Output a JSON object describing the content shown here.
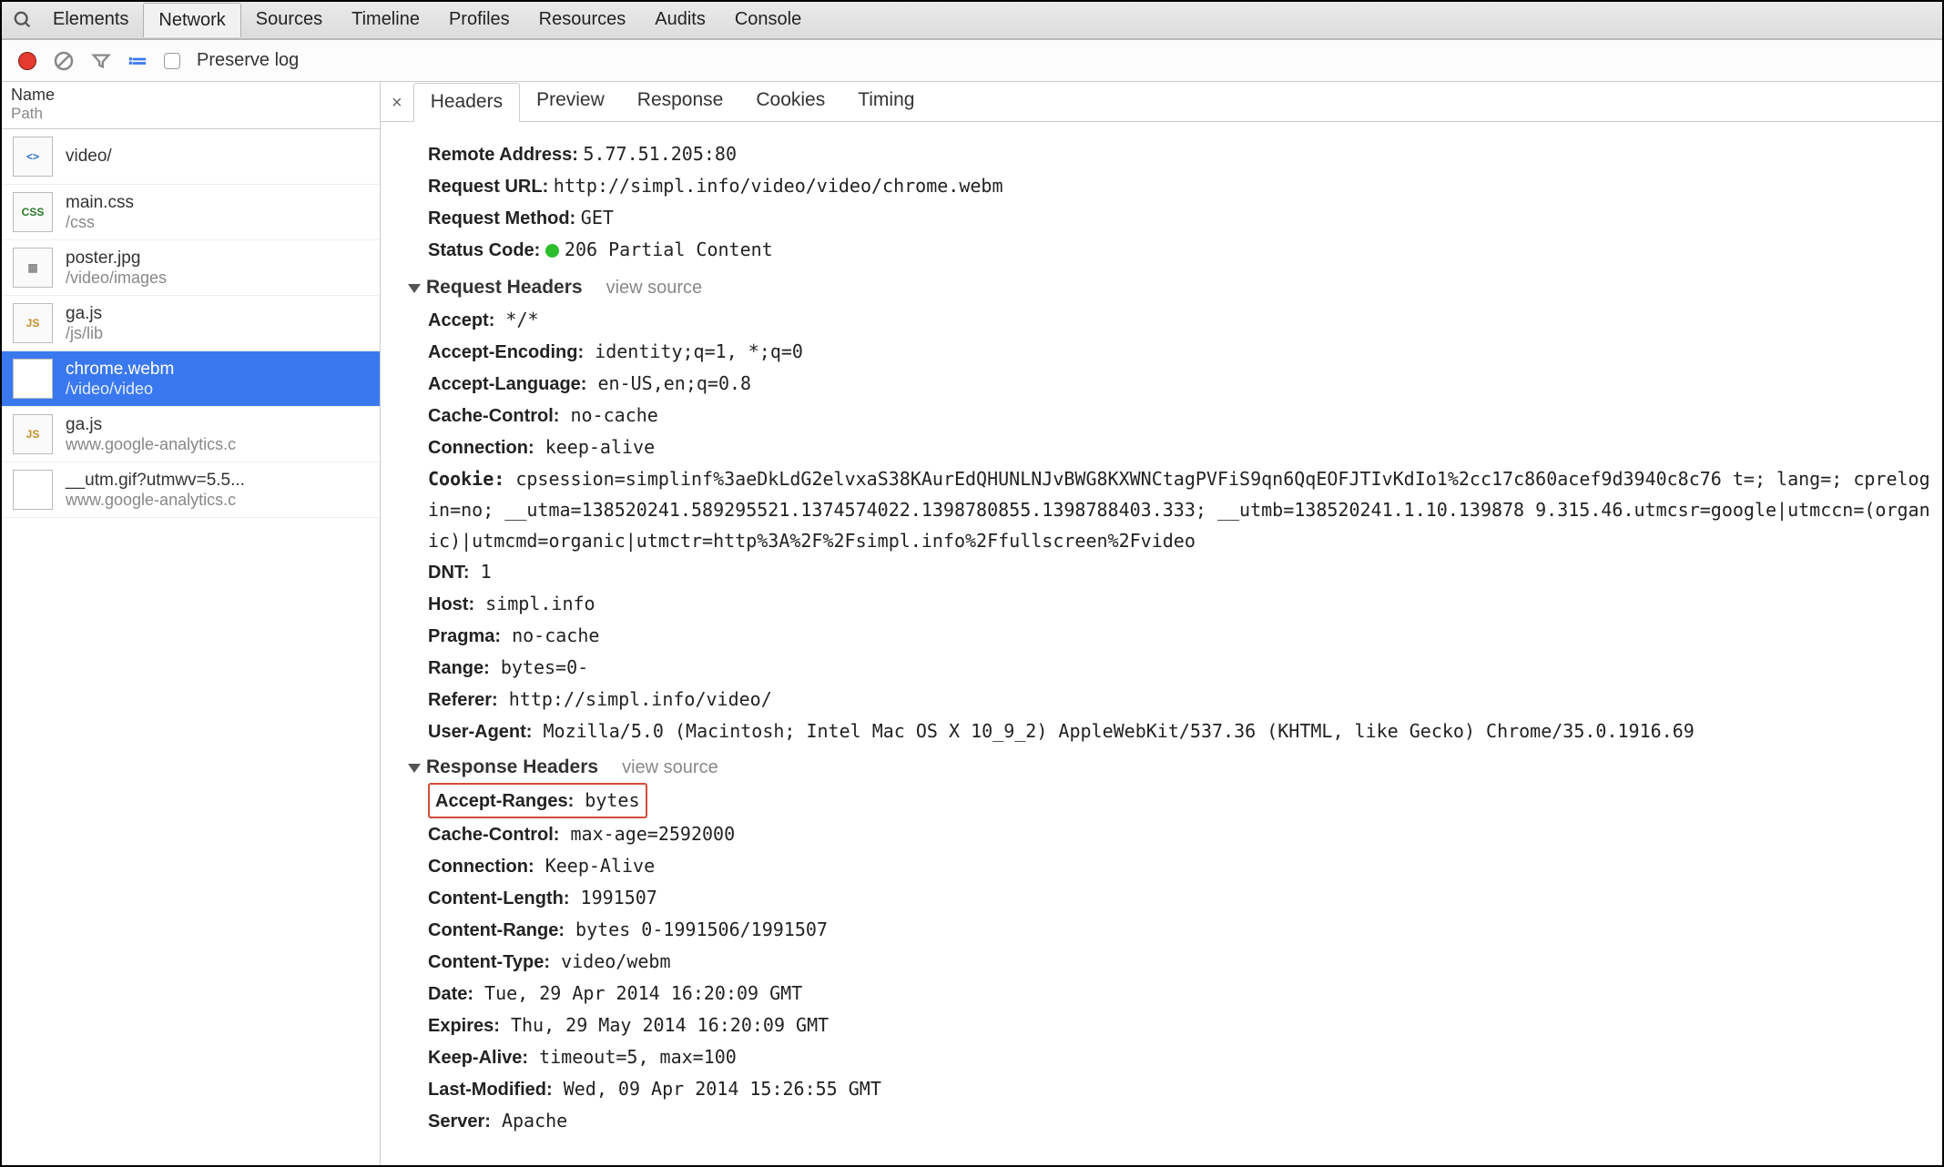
{
  "panels": [
    "Elements",
    "Network",
    "Sources",
    "Timeline",
    "Profiles",
    "Resources",
    "Audits",
    "Console"
  ],
  "active_panel": "Network",
  "toolbar": {
    "preserve_log": "Preserve log"
  },
  "list_header": {
    "name": "Name",
    "path": "Path"
  },
  "requests": [
    {
      "name": "video/",
      "path": "",
      "icon": "<>",
      "cls": "html"
    },
    {
      "name": "main.css",
      "path": "/css",
      "icon": "CSS",
      "cls": "css"
    },
    {
      "name": "poster.jpg",
      "path": "/video/images",
      "icon": "▦",
      "cls": "img"
    },
    {
      "name": "ga.js",
      "path": "/js/lib",
      "icon": "JS",
      "cls": "js"
    },
    {
      "name": "chrome.webm",
      "path": "/video/video",
      "icon": "",
      "cls": "media",
      "selected": true
    },
    {
      "name": "ga.js",
      "path": "www.google-analytics.c",
      "icon": "JS",
      "cls": "js"
    },
    {
      "name": "__utm.gif?utmwv=5.5...",
      "path": "www.google-analytics.c",
      "icon": "",
      "cls": "media"
    }
  ],
  "detail_tabs": [
    "Headers",
    "Preview",
    "Response",
    "Cookies",
    "Timing"
  ],
  "active_detail_tab": "Headers",
  "general": {
    "remote_address_k": "Remote Address:",
    "remote_address_v": "5.77.51.205:80",
    "request_url_k": "Request URL:",
    "request_url_v": "http://simpl.info/video/video/chrome.webm",
    "request_method_k": "Request Method:",
    "request_method_v": "GET",
    "status_code_k": "Status Code:",
    "status_code_v": "206 Partial Content"
  },
  "section_request_headers": "Request Headers",
  "section_response_headers": "Response Headers",
  "view_source": "view source",
  "request_headers": [
    {
      "k": "Accept:",
      "v": "*/*"
    },
    {
      "k": "Accept-Encoding:",
      "v": "identity;q=1, *;q=0"
    },
    {
      "k": "Accept-Language:",
      "v": "en-US,en;q=0.8"
    },
    {
      "k": "Cache-Control:",
      "v": "no-cache"
    },
    {
      "k": "Connection:",
      "v": "keep-alive"
    },
    {
      "k": "Cookie:",
      "v": "cpsession=simplinf%3aeDkLdG2elvxaS38KAurEdQHUNLNJvBWG8KXWNCtagPVFiS9qn6QqEOFJTIvKdIo1%2cc17c860acef9d3940c8c76 t=; lang=; cprelogin=no; __utma=138520241.589295521.1374574022.1398780855.1398788403.333; __utmb=138520241.1.10.139878 9.315.46.utmcsr=google|utmccn=(organic)|utmcmd=organic|utmctr=http%3A%2F%2Fsimpl.info%2Ffullscreen%2Fvideo"
    },
    {
      "k": "DNT:",
      "v": "1"
    },
    {
      "k": "Host:",
      "v": "simpl.info"
    },
    {
      "k": "Pragma:",
      "v": "no-cache"
    },
    {
      "k": "Range:",
      "v": "bytes=0-"
    },
    {
      "k": "Referer:",
      "v": "http://simpl.info/video/"
    },
    {
      "k": "User-Agent:",
      "v": "Mozilla/5.0 (Macintosh; Intel Mac OS X 10_9_2) AppleWebKit/537.36 (KHTML, like Gecko) Chrome/35.0.1916.69"
    }
  ],
  "response_headers": [
    {
      "k": "Accept-Ranges:",
      "v": "bytes",
      "highlight": true
    },
    {
      "k": "Cache-Control:",
      "v": "max-age=2592000"
    },
    {
      "k": "Connection:",
      "v": "Keep-Alive"
    },
    {
      "k": "Content-Length:",
      "v": "1991507"
    },
    {
      "k": "Content-Range:",
      "v": "bytes 0-1991506/1991507"
    },
    {
      "k": "Content-Type:",
      "v": "video/webm"
    },
    {
      "k": "Date:",
      "v": "Tue, 29 Apr 2014 16:20:09 GMT"
    },
    {
      "k": "Expires:",
      "v": "Thu, 29 May 2014 16:20:09 GMT"
    },
    {
      "k": "Keep-Alive:",
      "v": "timeout=5, max=100"
    },
    {
      "k": "Last-Modified:",
      "v": "Wed, 09 Apr 2014 15:26:55 GMT"
    },
    {
      "k": "Server:",
      "v": "Apache"
    }
  ]
}
